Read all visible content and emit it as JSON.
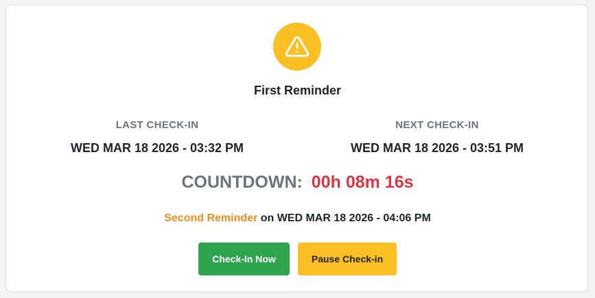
{
  "status": {
    "icon": "warning-triangle-icon",
    "title": "First Reminder"
  },
  "last_checkin": {
    "label": "LAST CHECK-IN",
    "value": "WED MAR 18 2026 - 03:32 PM"
  },
  "next_checkin": {
    "label": "NEXT CHECK-IN",
    "value": "WED MAR 18 2026 - 03:51 PM"
  },
  "countdown": {
    "label": "COUNTDOWN:",
    "value": "00h 08m 16s"
  },
  "next_reminder": {
    "name": "Second Reminder",
    "text": "on WED MAR 18 2026 - 04:06 PM"
  },
  "actions": {
    "checkin_label": "Check-In Now",
    "pause_label": "Pause Check-in"
  },
  "colors": {
    "warning": "#fbbf24",
    "danger": "#dc3545",
    "success": "#2ea44f",
    "reminder": "#f08c1a"
  }
}
